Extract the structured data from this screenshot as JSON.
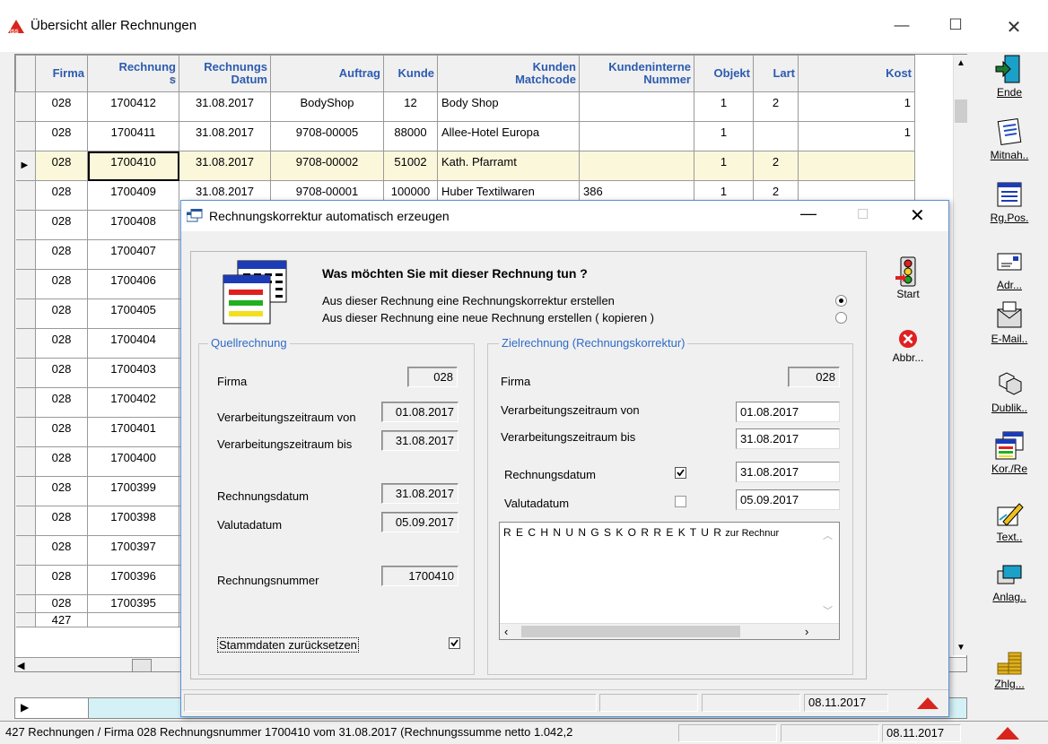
{
  "main": {
    "title": "Übersicht aller Rechnungen",
    "columns": [
      "Firma",
      "Rechnung\ns",
      "Rechnungs\nDatum",
      "Auftrag",
      "Kunde",
      "Kunden\nMatchcode",
      "Kundeninterne\nNummer",
      "Objekt",
      "Lart",
      "Kost"
    ],
    "rows": [
      [
        "028",
        "1700412",
        "31.08.2017",
        "BodyShop",
        "12",
        "Body Shop",
        "",
        "1",
        "2",
        "1"
      ],
      [
        "028",
        "1700411",
        "31.08.2017",
        "9708-00005",
        "88000",
        "Allee-Hotel Europa",
        "",
        "1",
        "",
        "1"
      ],
      [
        "028",
        "1700410",
        "31.08.2017",
        "9708-00002",
        "51002",
        "Kath. Pfarramt",
        "",
        "1",
        "2",
        ""
      ],
      [
        "028",
        "1700409",
        "31.08.2017",
        "9708-00001",
        "100000",
        "Huber Textilwaren",
        "386",
        "1",
        "2",
        ""
      ],
      [
        "028",
        "1700408",
        "",
        "",
        "",
        "",
        "",
        "",
        "",
        ""
      ],
      [
        "028",
        "1700407",
        "",
        "",
        "",
        "",
        "",
        "",
        "",
        ""
      ],
      [
        "028",
        "1700406",
        "",
        "",
        "",
        "",
        "",
        "",
        "",
        ""
      ],
      [
        "028",
        "1700405",
        "",
        "",
        "",
        "",
        "",
        "",
        "",
        ""
      ],
      [
        "028",
        "1700404",
        "",
        "",
        "",
        "",
        "",
        "",
        "",
        ""
      ],
      [
        "028",
        "1700403",
        "",
        "",
        "",
        "",
        "",
        "",
        "",
        ""
      ],
      [
        "028",
        "1700402",
        "",
        "",
        "",
        "",
        "",
        "",
        "",
        ""
      ],
      [
        "028",
        "1700401",
        "",
        "",
        "",
        "",
        "",
        "",
        "",
        ""
      ],
      [
        "028",
        "1700400",
        "",
        "",
        "",
        "",
        "",
        "",
        "",
        ""
      ],
      [
        "028",
        "1700399",
        "",
        "",
        "",
        "",
        "",
        "",
        "",
        ""
      ],
      [
        "028",
        "1700398",
        "",
        "",
        "",
        "",
        "",
        "",
        "",
        ""
      ],
      [
        "028",
        "1700397",
        "",
        "",
        "",
        "",
        "",
        "",
        "",
        ""
      ],
      [
        "028",
        "1700396",
        "",
        "",
        "",
        "",
        "",
        "",
        "",
        ""
      ],
      [
        "028",
        "1700395",
        "",
        "",
        "",
        "",
        "",
        "",
        "",
        ""
      ]
    ],
    "count_row": "427"
  },
  "toolbar": [
    {
      "label": "Ende",
      "icon": "exit-door-icon"
    },
    {
      "label": "Mitnah..",
      "icon": "notepad-icon"
    },
    {
      "label": "Rg.Pos.",
      "icon": "invoice-lines-icon"
    },
    {
      "label": "Adr...",
      "icon": "address-card-icon"
    },
    {
      "label": "E-Mail..",
      "icon": "email-icon"
    },
    {
      "label": "Dublik..",
      "icon": "duplicate-cubes-icon"
    },
    {
      "label": "Kor./Re",
      "icon": "correction-window-icon"
    },
    {
      "label": "Text..",
      "icon": "text-pen-icon"
    },
    {
      "label": "Anlag..",
      "icon": "attachments-icon"
    },
    {
      "label": "Zhlg...",
      "icon": "coins-icon"
    }
  ],
  "statusbar": {
    "text": "427 Rechnungen / Firma 028 Rechnungsnummer 1700410 vom 31.08.2017 (Rechnungssumme netto 1.042,2",
    "date": "08.11.2017"
  },
  "dialog": {
    "title": "Rechnungskorrektur automatisch erzeugen",
    "question": "Was möchten Sie mit dieser Rechnung tun ?",
    "option1": "Aus dieser Rechnung eine Rechnungskorrektur erstellen",
    "option2": "Aus dieser Rechnung eine neue Rechnung erstellen ( kopieren )",
    "option_selected": 1,
    "start_label": "Start",
    "cancel_label": "Abbr...",
    "source": {
      "legend": "Quellrechnung",
      "firma_label": "Firma",
      "firma": "028",
      "von_label": "Verarbeitungszeitraum von",
      "von": "01.08.2017",
      "bis_label": "Verarbeitungszeitraum bis",
      "bis": "31.08.2017",
      "rdatum_label": "Rechnungsdatum",
      "rdatum": "31.08.2017",
      "valuta_label": "Valutadatum",
      "valuta": "05.09.2017",
      "nummer_label": "Rechnungsnummer",
      "nummer": "1700410",
      "reset_label": "Stammdaten zurücksetzen",
      "reset_checked": true
    },
    "target": {
      "legend": "Zielrechnung (Rechnungskorrektur)",
      "firma_label": "Firma",
      "firma": "028",
      "von_label": "Verarbeitungszeitraum von",
      "von": "01.08.2017",
      "bis_label": "Verarbeitungszeitraum bis",
      "bis": "31.08.2017",
      "rdatum_label": "Rechnungsdatum",
      "rdatum": "31.08.2017",
      "rdatum_checked": true,
      "valuta_label": "Valutadatum",
      "valuta": "05.09.2017",
      "valuta_checked": false,
      "text_spaced": "R E C H N U N G S K O R R E K T U R",
      "text_rest": "zur Rechnur"
    },
    "status_date": "08.11.2017"
  }
}
